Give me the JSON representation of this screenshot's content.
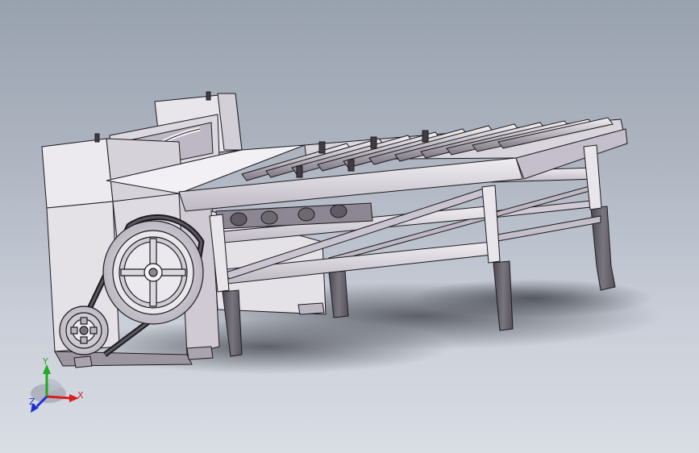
{
  "viewport": {
    "background_top": "#98a1ae",
    "background_bottom": "#d9dde4",
    "model_fill": "#e6e3e8",
    "model_shade": "#c9c4cc",
    "model_dark": "#6d6970",
    "edge_color": "#1c1a1e"
  },
  "triad": {
    "x_label": "X",
    "y_label": "Y",
    "z_label": "Z",
    "x_color": "#d81f1f",
    "y_color": "#1faa1f",
    "z_color": "#1f2fd8"
  }
}
